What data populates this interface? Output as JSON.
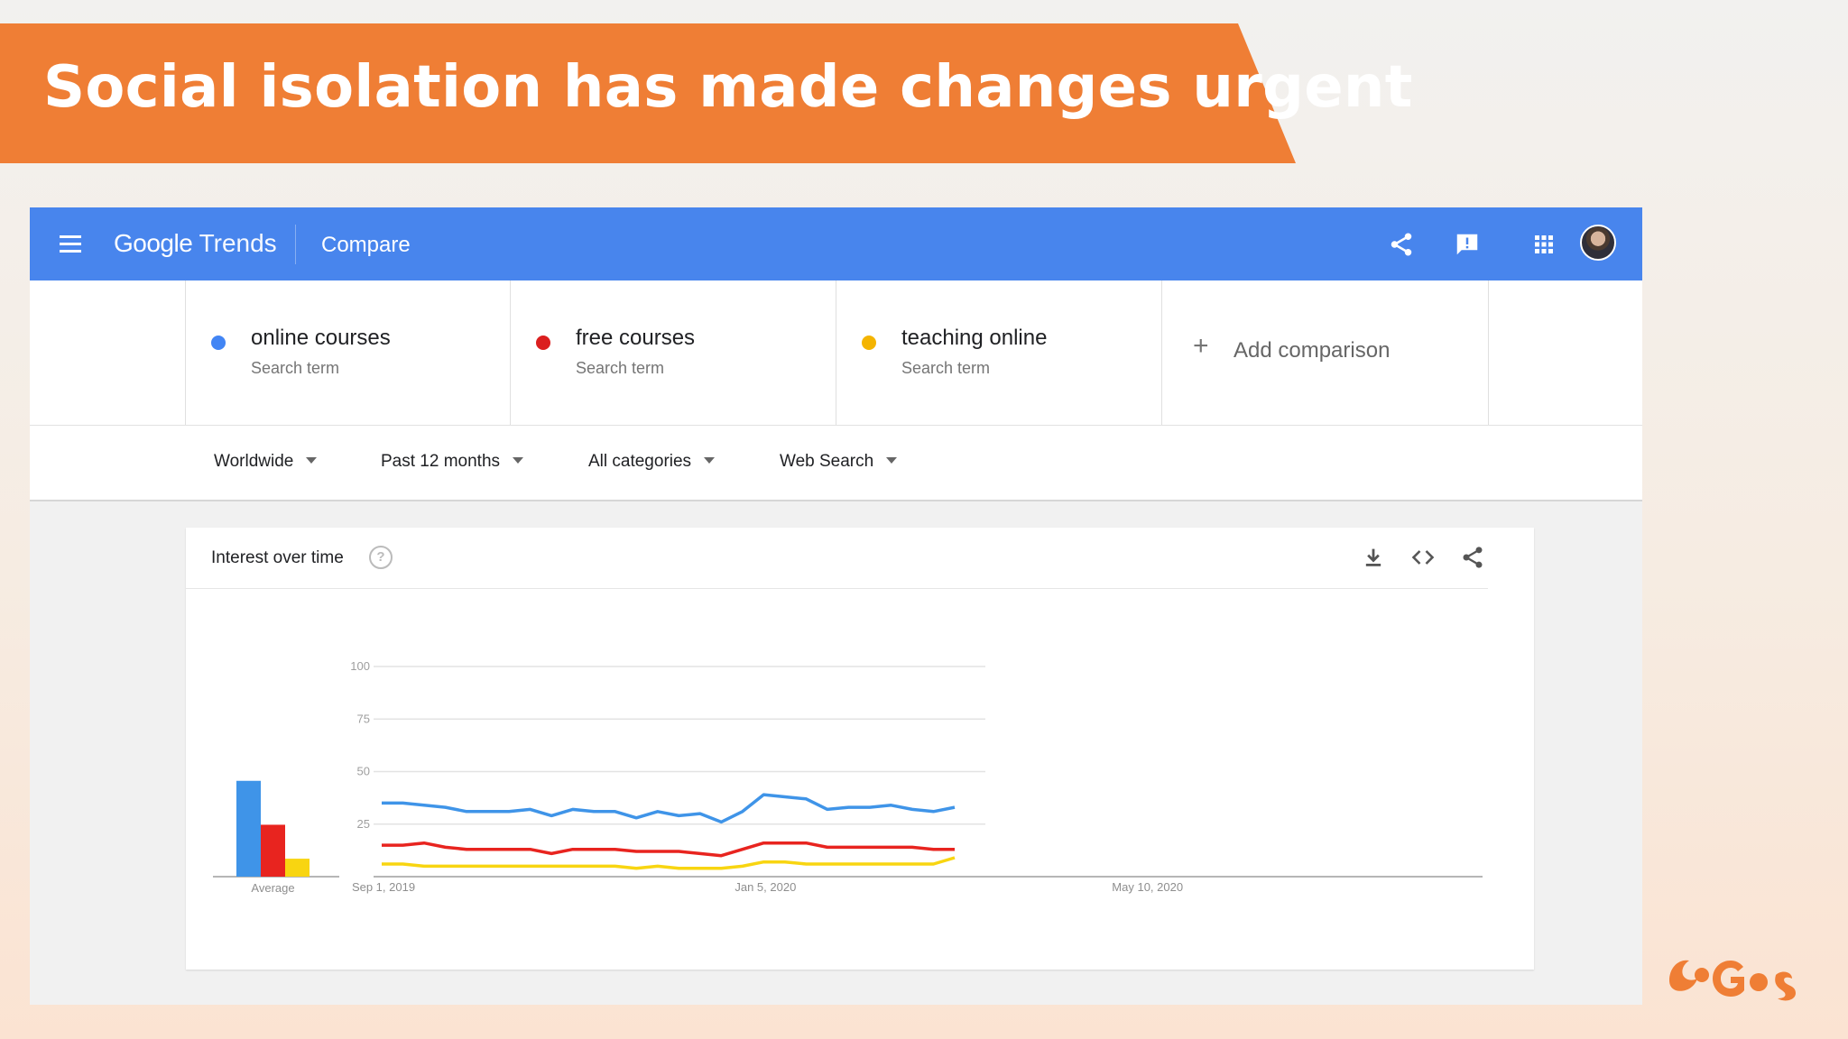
{
  "slide": {
    "title": "Social isolation has made changes urgent",
    "accent_color": "#ef7e35"
  },
  "header": {
    "menu_icon": "hamburger-icon",
    "logo_google": "Google",
    "logo_trends": "Trends",
    "section": "Compare",
    "icons": [
      "share-icon",
      "feedback-icon",
      "apps-grid-icon",
      "avatar"
    ],
    "bar_color": "#4885ed"
  },
  "terms": [
    {
      "name": "online courses",
      "sub": "Search term",
      "color": "#4285f4"
    },
    {
      "name": "free courses",
      "sub": "Search term",
      "color": "#db1f1f"
    },
    {
      "name": "teaching online",
      "sub": "Search term",
      "color": "#f4b400"
    }
  ],
  "add_comparison": "Add comparison",
  "filters": {
    "region": "Worldwide",
    "time": "Past 12 months",
    "category": "All categories",
    "search_type": "Web Search"
  },
  "card": {
    "title": "Interest over time",
    "help_glyph": "?",
    "icons": [
      "download-icon",
      "embed-code-icon",
      "share-icon"
    ]
  },
  "chart_data": {
    "type": "line",
    "title": "Interest over time",
    "ylim": [
      0,
      100
    ],
    "y_ticks": [
      25,
      50,
      75,
      100
    ],
    "x_tick_labels": [
      "Sep 1, 2019",
      "Jan 5, 2020",
      "May 10, 2020"
    ],
    "x_tick_positions": [
      0,
      18,
      36
    ],
    "x_max_weeks": 52,
    "grid": true,
    "average_label": "Average",
    "averages": [
      48,
      26,
      9
    ],
    "series": [
      {
        "name": "online courses",
        "color": "#3f94e8",
        "values": [
          35,
          35,
          34,
          33,
          31,
          31,
          31,
          32,
          29,
          32,
          31,
          31,
          28,
          31,
          29,
          30,
          26,
          31,
          39,
          38,
          37,
          32,
          33,
          33,
          34,
          32,
          31,
          33
        ]
      },
      {
        "name": "free courses",
        "color": "#e8241f",
        "values": [
          15,
          15,
          16,
          14,
          13,
          13,
          13,
          13,
          11,
          13,
          13,
          13,
          12,
          12,
          12,
          11,
          10,
          13,
          16,
          16,
          16,
          14,
          14,
          14,
          14,
          14,
          13,
          13
        ]
      },
      {
        "name": "teaching online",
        "color": "#f8d511",
        "values": [
          6,
          6,
          5,
          5,
          5,
          5,
          5,
          5,
          5,
          5,
          5,
          5,
          4,
          5,
          4,
          4,
          4,
          5,
          7,
          7,
          6,
          6,
          6,
          6,
          6,
          6,
          6,
          9
        ]
      }
    ]
  }
}
